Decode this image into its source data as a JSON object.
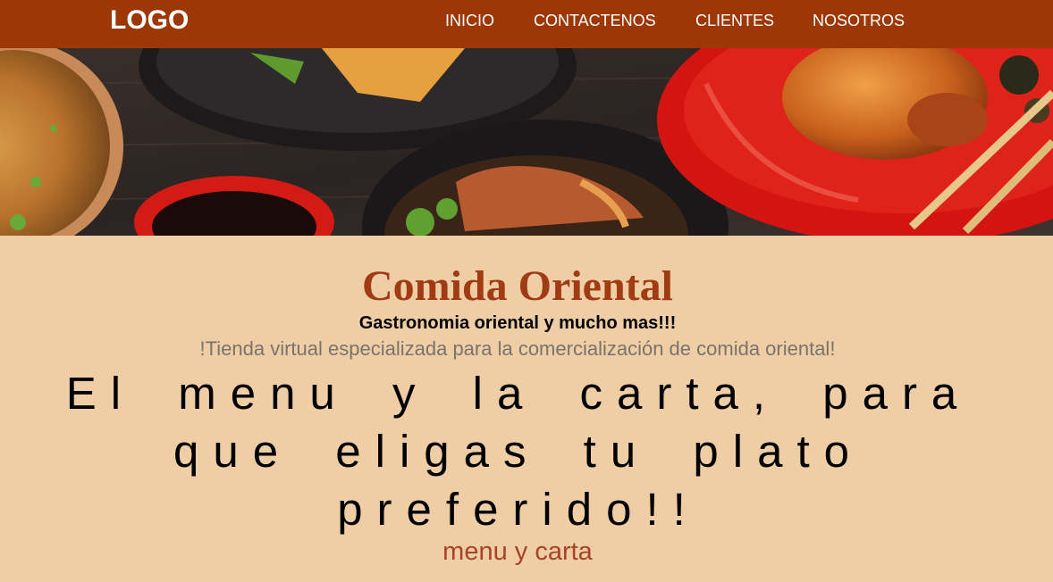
{
  "nav": {
    "logo": "LOGO",
    "links": [
      "INICIO",
      "CONTACTENOS",
      "CLIENTES",
      "NOSOTROS"
    ]
  },
  "hero": {
    "image": "oriental-food-banner"
  },
  "main": {
    "title": "Comida Oriental",
    "subtitle": "Gastronomia oriental y mucho mas!!!",
    "tagline": "!Tienda virtual especializada para la comercialización de comida oriental!",
    "headline": "El menu y la carta, para que eligas tu plato preferido!!",
    "menu_link": "menu y carta"
  },
  "colors": {
    "navbar": "#9e3706",
    "page_background": "#efcea6",
    "title": "#a03b14",
    "tagline": "#7a736c",
    "menu_link": "#a84228"
  }
}
